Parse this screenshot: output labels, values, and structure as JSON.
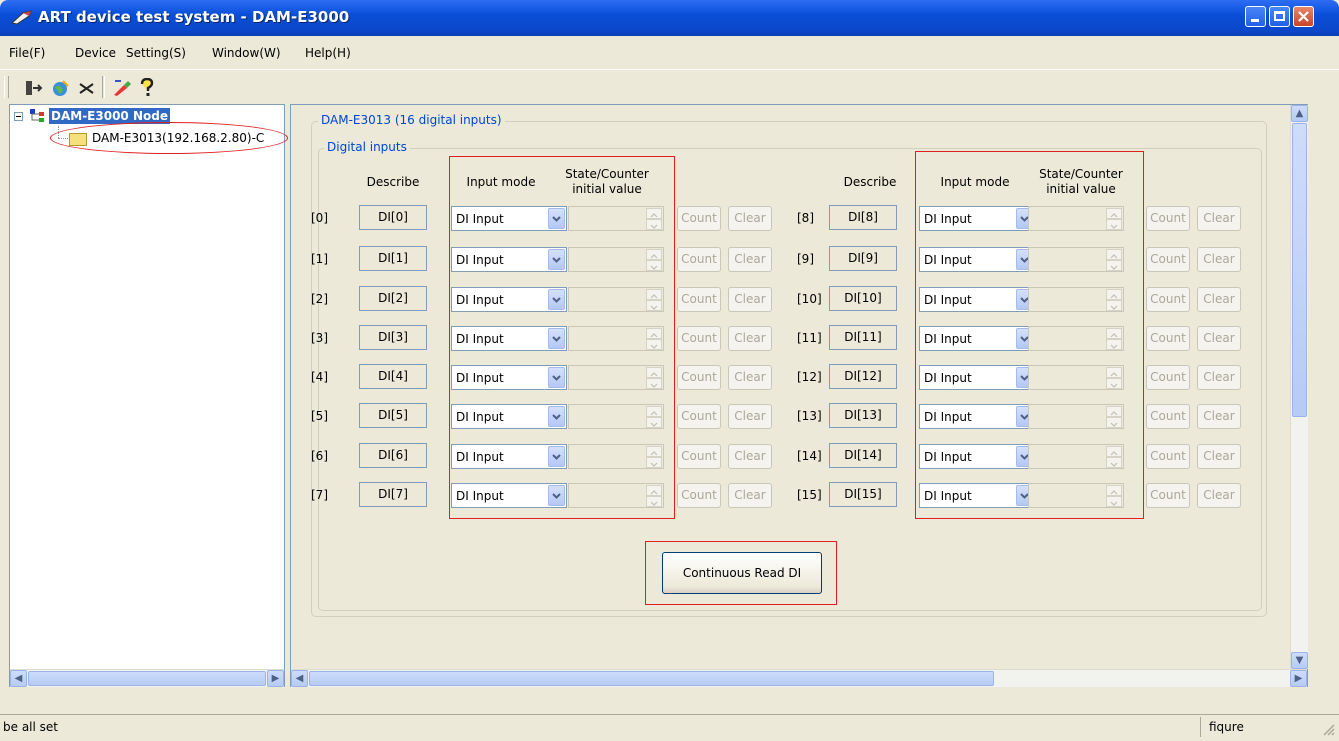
{
  "window": {
    "title": "ART device test system - DAM-E3000"
  },
  "menu": {
    "items": [
      {
        "label": "File(F)",
        "key": "F"
      },
      {
        "label": "Device",
        "key": ""
      },
      {
        "label": "Setting(S)",
        "key": "S"
      },
      {
        "label": "Window(W)",
        "key": "W"
      },
      {
        "label": "Help(H)",
        "key": "H"
      }
    ]
  },
  "toolbar": {
    "icons": [
      "connect-icon",
      "globe-icon",
      "disconnect-icon",
      "paint-icon",
      "help-icon"
    ]
  },
  "tree": {
    "root": "DAM-E3000 Node",
    "child": "DAM-E3013(192.168.2.80)-C"
  },
  "panel": {
    "title": "DAM-E3013 (16 digital inputs)",
    "group_label": "Digital inputs",
    "headers": {
      "describe": "Describe",
      "input_mode": "Input mode",
      "state_line1": "State/Counter",
      "state_line2": "initial value"
    },
    "count_label": "Count",
    "clear_label": "Clear",
    "left": [
      {
        "idx": "[0]",
        "desc": "DI[0]",
        "mode": "DI Input"
      },
      {
        "idx": "[1]",
        "desc": "DI[1]",
        "mode": "DI Input"
      },
      {
        "idx": "[2]",
        "desc": "DI[2]",
        "mode": "DI Input"
      },
      {
        "idx": "[3]",
        "desc": "DI[3]",
        "mode": "DI Input"
      },
      {
        "idx": "[4]",
        "desc": "DI[4]",
        "mode": "DI Input"
      },
      {
        "idx": "[5]",
        "desc": "DI[5]",
        "mode": "DI Input"
      },
      {
        "idx": "[6]",
        "desc": "DI[6]",
        "mode": "DI Input"
      },
      {
        "idx": "[7]",
        "desc": "DI[7]",
        "mode": "DI Input"
      }
    ],
    "right": [
      {
        "idx": "[8]",
        "desc": "DI[8]",
        "mode": "DI Input"
      },
      {
        "idx": "[9]",
        "desc": "DI[9]",
        "mode": "DI Input"
      },
      {
        "idx": "[10]",
        "desc": "DI[10]",
        "mode": "DI Input"
      },
      {
        "idx": "[11]",
        "desc": "DI[11]",
        "mode": "DI Input"
      },
      {
        "idx": "[12]",
        "desc": "DI[12]",
        "mode": "DI Input"
      },
      {
        "idx": "[13]",
        "desc": "DI[13]",
        "mode": "DI Input"
      },
      {
        "idx": "[14]",
        "desc": "DI[14]",
        "mode": "DI Input"
      },
      {
        "idx": "[15]",
        "desc": "DI[15]",
        "mode": "DI Input"
      }
    ],
    "continuous_button": "Continuous Read DI"
  },
  "status": {
    "left": "be all set",
    "right": "fiqure"
  },
  "colors": {
    "titlebar": "#0b47c9",
    "highlight": "#e02020",
    "group_label": "#0046d5"
  }
}
